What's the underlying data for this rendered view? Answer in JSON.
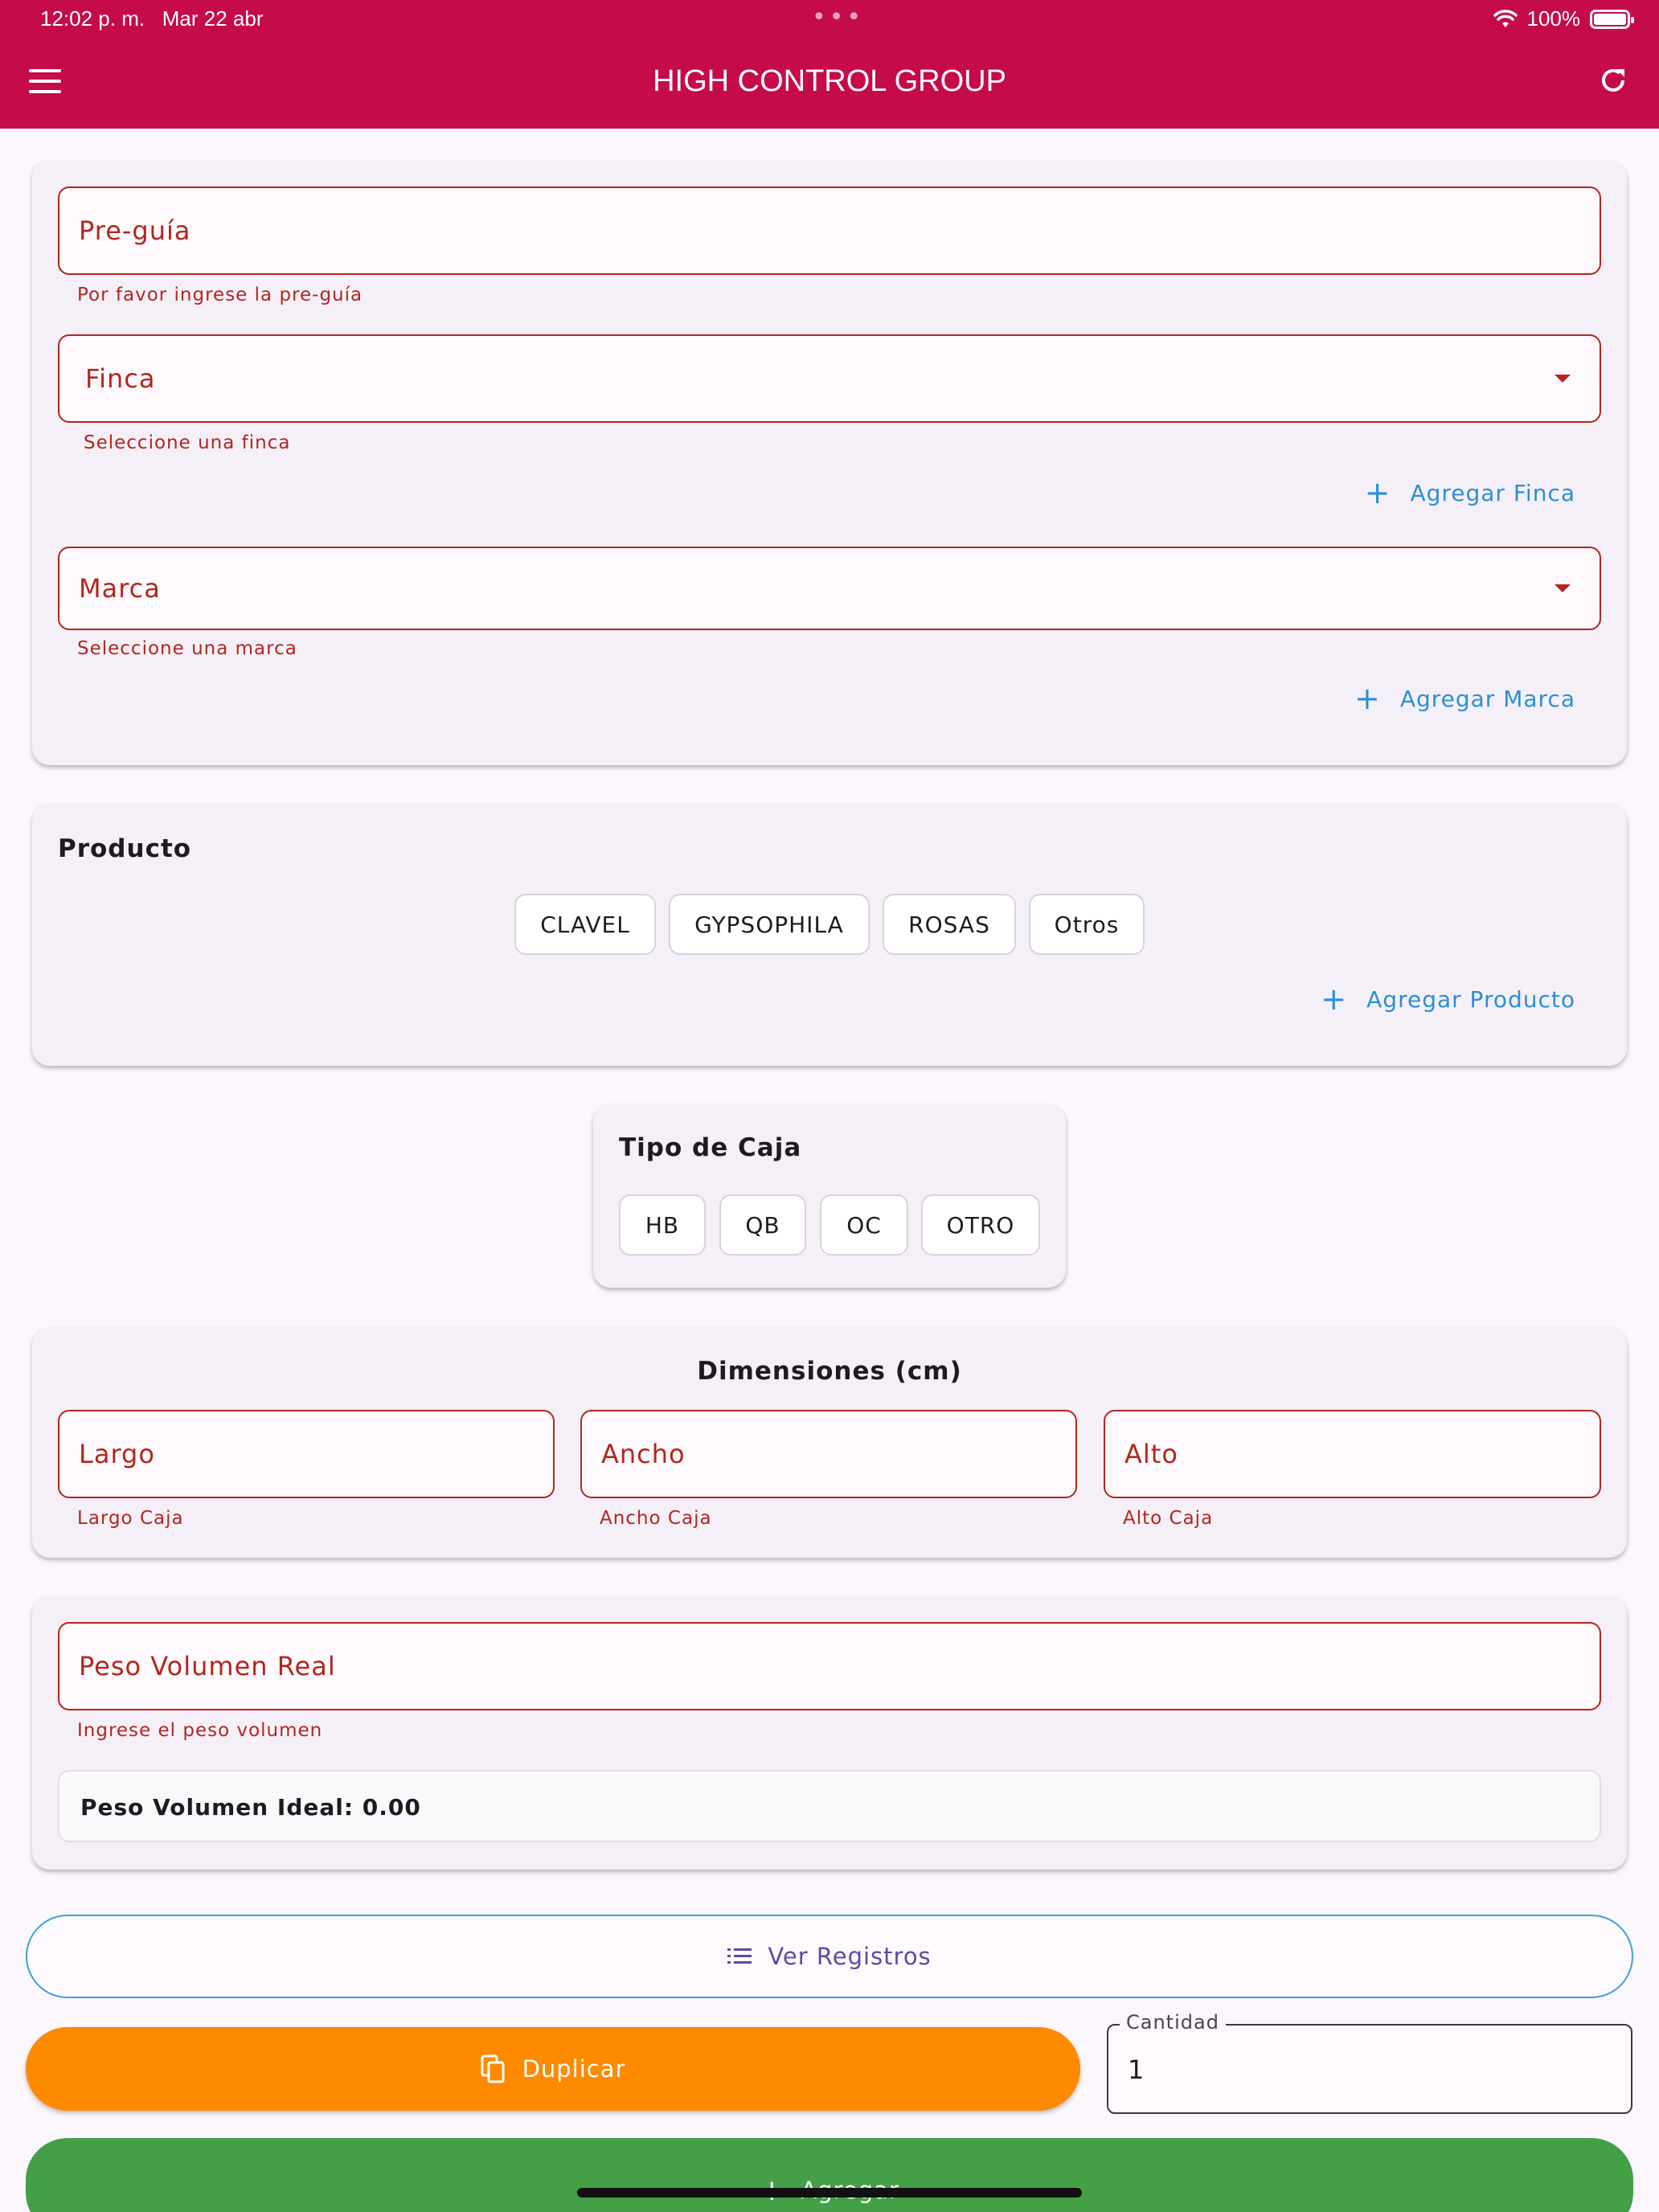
{
  "status_bar": {
    "time": "12:02 p. m.",
    "date": "Mar 22 abr",
    "dots": "•••",
    "wifi_icon": "wifi-icon",
    "battery": "100%"
  },
  "app_bar": {
    "title": "HIGH CONTROL GROUP",
    "menu_icon": "hamburger-menu-icon",
    "refresh_icon": "refresh-icon"
  },
  "form": {
    "pre_guia": {
      "label": "Pre-guía",
      "helper": "Por favor ingrese la pre-guía"
    },
    "finca": {
      "label": "Finca",
      "helper": "Seleccione una finca",
      "add_label": "Agregar Finca"
    },
    "marca": {
      "label": "Marca",
      "helper": "Seleccione una marca",
      "add_label": "Agregar Marca"
    }
  },
  "producto": {
    "title": "Producto",
    "options": [
      "CLAVEL",
      "GYPSOPHILA",
      "ROSAS",
      "Otros"
    ],
    "add_label": "Agregar Producto"
  },
  "tipo_caja": {
    "title": "Tipo de Caja",
    "options": [
      "HB",
      "QB",
      "OC",
      "OTRO"
    ]
  },
  "dimensiones": {
    "title": "Dimensiones (cm)",
    "largo": {
      "label": "Largo",
      "helper": "Largo Caja"
    },
    "ancho": {
      "label": "Ancho",
      "helper": "Ancho Caja"
    },
    "alto": {
      "label": "Alto",
      "helper": "Alto Caja"
    }
  },
  "peso": {
    "real_label": "Peso Volumen Real",
    "real_helper": "Ingrese el peso volumen",
    "ideal_text": "Peso Volumen Ideal: 0.00"
  },
  "actions": {
    "ver_registros": "Ver Registros",
    "duplicar": "Duplicar",
    "cantidad_label": "Cantidad",
    "cantidad_value": "1",
    "agregar": "Agregar"
  },
  "colors": {
    "primary": "#c60b4a",
    "error": "#b3261e",
    "link": "#2b8fd6",
    "orange": "#fd8a00",
    "green": "#43a047"
  }
}
